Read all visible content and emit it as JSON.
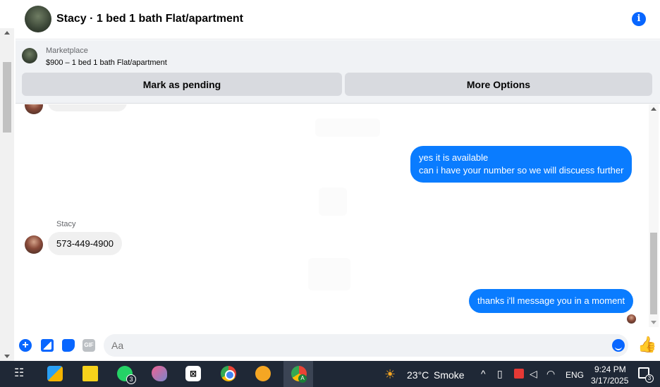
{
  "header": {
    "title": "Stacy · 1 bed 1 bath Flat/apartment",
    "info_glyph": "i"
  },
  "marketplace": {
    "label": "Marketplace",
    "listing": "$900 – 1 bed 1 bath Flat/apartment",
    "mark_pending_label": "Mark as pending",
    "more_options_label": "More Options"
  },
  "messages": [
    {
      "direction": "outgoing",
      "lines": [
        "yes it is available",
        "can i have your number so we will discuess further"
      ]
    },
    {
      "direction": "incoming",
      "sender": "Stacy",
      "text": "573-449-4900"
    },
    {
      "direction": "outgoing",
      "text": "thanks i'll message you in a moment"
    }
  ],
  "composer": {
    "placeholder": "Aa",
    "gif_label": "GIF",
    "plus_glyph": "+",
    "like_glyph": "👍"
  },
  "taskbar": {
    "whatsapp_badge": "3",
    "capcut_glyph": "⊠",
    "active_badge": "A",
    "weather_temp": "23°C",
    "weather_desc": "Smoke",
    "language": "ENG",
    "time": "9:24 PM",
    "date": "3/17/2025",
    "notification_badge": "3"
  },
  "colors": {
    "accent": "#0866ff",
    "outgoing_bubble": "#0a7cff",
    "incoming_bubble": "#f0f0f0",
    "taskbar": "#1f2836"
  }
}
